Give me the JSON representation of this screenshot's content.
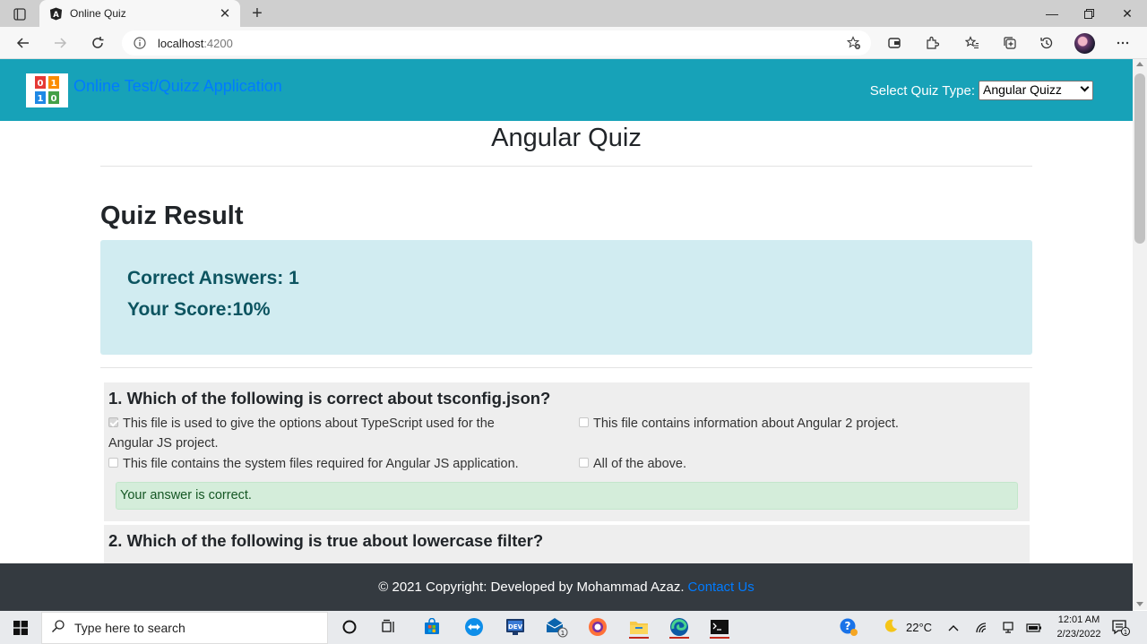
{
  "browser": {
    "tab_title": "Online Quiz",
    "url_host": "localhost",
    "url_port": ":4200"
  },
  "navbar": {
    "brand": "Online Test/Quizz Application",
    "quiz_type_label": "Select Quiz Type:",
    "quiz_type_selected": "Angular Quizz",
    "color": "#17a2b8"
  },
  "page": {
    "title": "Angular Quiz",
    "result_heading": "Quiz Result",
    "correct_answers": "Correct Answers: 1",
    "score": "Your Score:10%"
  },
  "questions": [
    {
      "text": "1. Which of the following is correct about tsconfig.json?",
      "options": [
        {
          "label_line1": "This file is used to give the options about TypeScript used for the",
          "label_line2": "Angular JS project.",
          "checked": true
        },
        {
          "label": "This file contains information about Angular 2 project.",
          "checked": false
        },
        {
          "label": "This file contains the system files required for Angular JS application.",
          "checked": false
        },
        {
          "label": "All of the above.",
          "checked": false
        }
      ],
      "feedback": "Your answer is correct."
    },
    {
      "text": "2. Which of the following is true about lowercase filter?"
    }
  ],
  "footer": {
    "copyright": "© 2021 Copyright: Developed by Mohammad Azaz.",
    "contact_link": "Contact Us"
  },
  "taskbar": {
    "search_placeholder": "Type here to search",
    "temperature": "22°C",
    "time": "12:01 AM",
    "date": "2/23/2022",
    "mail_badge": "1",
    "notification_badge": "1"
  }
}
